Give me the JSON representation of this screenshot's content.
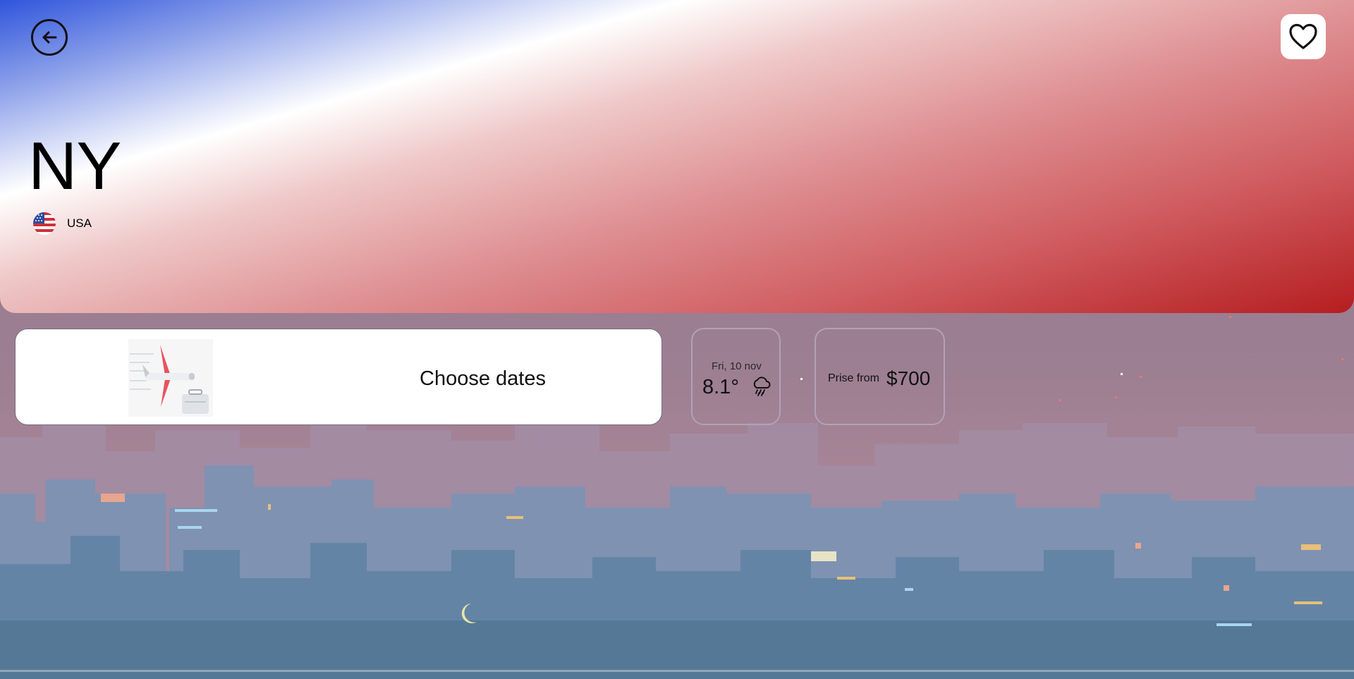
{
  "destination": {
    "city": "NY",
    "country": "USA",
    "flag_icon": "usa-flag-icon"
  },
  "header": {
    "back_icon": "back-arrow-icon",
    "favorite_icon": "heart-icon"
  },
  "booking": {
    "choose_dates_label": "Choose dates",
    "illustration_icon": "airplane-luggage-icon"
  },
  "weather": {
    "date": "Fri, 10 nov",
    "temperature": "8.1°",
    "condition_icon": "rain-cloud-icon"
  },
  "price": {
    "label": "Prise from",
    "value": "$700"
  },
  "colors": {
    "gradient_blue": "#2f55dc",
    "gradient_white": "#ffffff",
    "gradient_red": "#b51e20",
    "sky": "#9a7b8e",
    "buildings": "#5e7fa0"
  }
}
